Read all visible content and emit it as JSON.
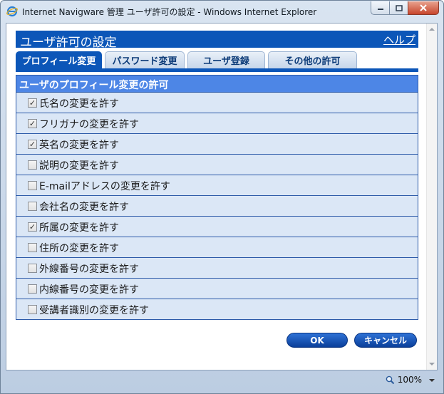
{
  "window": {
    "title": "Internet Navigware 管理 ユーザ許可の設定 - Windows Internet Explorer"
  },
  "header": {
    "title": "ユーザ許可の設定",
    "help_label": "ヘルプ"
  },
  "tabs": [
    {
      "label": "プロフィール変更",
      "active": true
    },
    {
      "label": "パスワード変更",
      "active": false
    },
    {
      "label": "ユーザ登録",
      "active": false
    },
    {
      "label": "その他の許可",
      "active": false
    }
  ],
  "section": {
    "title": "ユーザのプロフィール変更の許可"
  },
  "permissions": [
    {
      "label": "氏名の変更を許す",
      "checked": true,
      "check_mark": "✓"
    },
    {
      "label": "フリガナの変更を許す",
      "checked": true,
      "check_mark": "✓"
    },
    {
      "label": "英名の変更を許す",
      "checked": true,
      "check_mark": "✓"
    },
    {
      "label": "説明の変更を許す",
      "checked": false,
      "check_mark": ""
    },
    {
      "label": "E-mailアドレスの変更を許す",
      "checked": false,
      "check_mark": ""
    },
    {
      "label": "会社名の変更を許す",
      "checked": false,
      "check_mark": ""
    },
    {
      "label": "所属の変更を許す",
      "checked": true,
      "check_mark": "✓"
    },
    {
      "label": "住所の変更を許す",
      "checked": false,
      "check_mark": ""
    },
    {
      "label": "外線番号の変更を許す",
      "checked": false,
      "check_mark": ""
    },
    {
      "label": "内線番号の変更を許す",
      "checked": false,
      "check_mark": ""
    },
    {
      "label": "受講者識別の変更を許す",
      "checked": false,
      "check_mark": ""
    }
  ],
  "buttons": {
    "ok_label": "OK",
    "cancel_label": "キャンセル"
  },
  "status": {
    "zoom_label": "100%"
  },
  "colors": {
    "accent": "#0c56b8",
    "section_header": "#4d86e6",
    "row_bg": "#dbe7f6"
  },
  "icons": {
    "browser": "ie-logo-icon",
    "zoom": "magnifier-icon"
  }
}
